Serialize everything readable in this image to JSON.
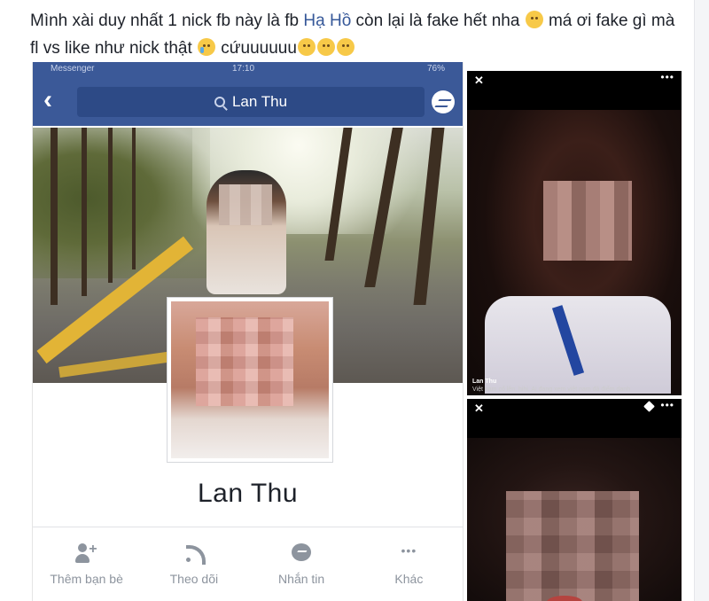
{
  "post": {
    "text_part1": "Mình xài duy nhất 1 nick fb này là fb ",
    "mention": "Hạ Hồ",
    "text_part2": " còn lại là fake hết nha ",
    "text_part3": " má ơi fake gì mà fl vs like như nick thật ",
    "text_part4": " cứuuuuuu"
  },
  "phone": {
    "status_left": "Messenger",
    "status_center": "17:10",
    "status_right": "76%",
    "search_query": "Lan Thu",
    "profile_name": "Lan Thu",
    "actions": [
      {
        "label": "Thêm bạn bè",
        "icon": "add-friend-icon"
      },
      {
        "label": "Theo dõi",
        "icon": "follow-icon"
      },
      {
        "label": "Nhắn tin",
        "icon": "messenger-icon"
      },
      {
        "label": "Khác",
        "icon": "more-icon"
      }
    ]
  },
  "viewer1": {
    "close": "✕",
    "more": "•••",
    "caption_name": "Lan Thu",
    "caption_text": "Việt nam cố lên. hihi. Ai đang xem việt nam đã điểm danh"
  },
  "viewer2": {
    "close": "✕",
    "more": "•••"
  },
  "colors": {
    "facebook_blue": "#3b5998",
    "mention_blue": "#365899",
    "action_gray": "#8d949e"
  }
}
